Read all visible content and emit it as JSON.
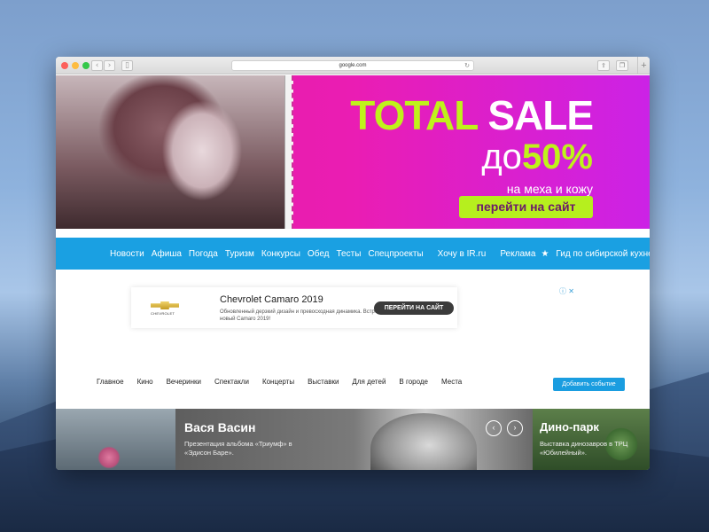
{
  "browser": {
    "url": "google.com",
    "back": "‹",
    "forward": "›",
    "reload": "↻",
    "new_tab": "+"
  },
  "hero": {
    "total": "TOTAL",
    "sale": "SALE",
    "do": "до",
    "percent": "50%",
    "subtitle": "на меха и кожу",
    "cta": "перейти на сайт"
  },
  "main_nav": {
    "items": [
      "Новости",
      "Афиша",
      "Погода",
      "Туризм",
      "Конкурсы",
      "Обед",
      "Тесты",
      "Спецпроекты",
      "Хочу в IR.ru",
      "Реклама",
      "Гид по сибирской кухне"
    ]
  },
  "ad": {
    "brand": "CHEVROLET",
    "title": "Chevrolet Camaro 2019",
    "description": "Обновленный дерзкий дизайн и превосходная динамика. Встречайте новый Camaro 2019!",
    "button": "ПЕРЕЙТИ НА САЙТ",
    "adchoices": "ⓘ ✕"
  },
  "sub_nav": {
    "items": [
      "Главное",
      "Кино",
      "Вечеринки",
      "Спектакли",
      "Концерты",
      "Выставки",
      "Для детей",
      "В городе",
      "Места"
    ],
    "add_event": "Добавить событие"
  },
  "carousel": {
    "main_title": "Вася Васин",
    "main_desc": "Презентация альбома «Триумф» в «Эдисон Баре».",
    "prev": "‹",
    "next": "›",
    "right_title": "Дино-парк",
    "right_desc": "Выставка динозавров в ТРЦ «Юбилейный»."
  }
}
